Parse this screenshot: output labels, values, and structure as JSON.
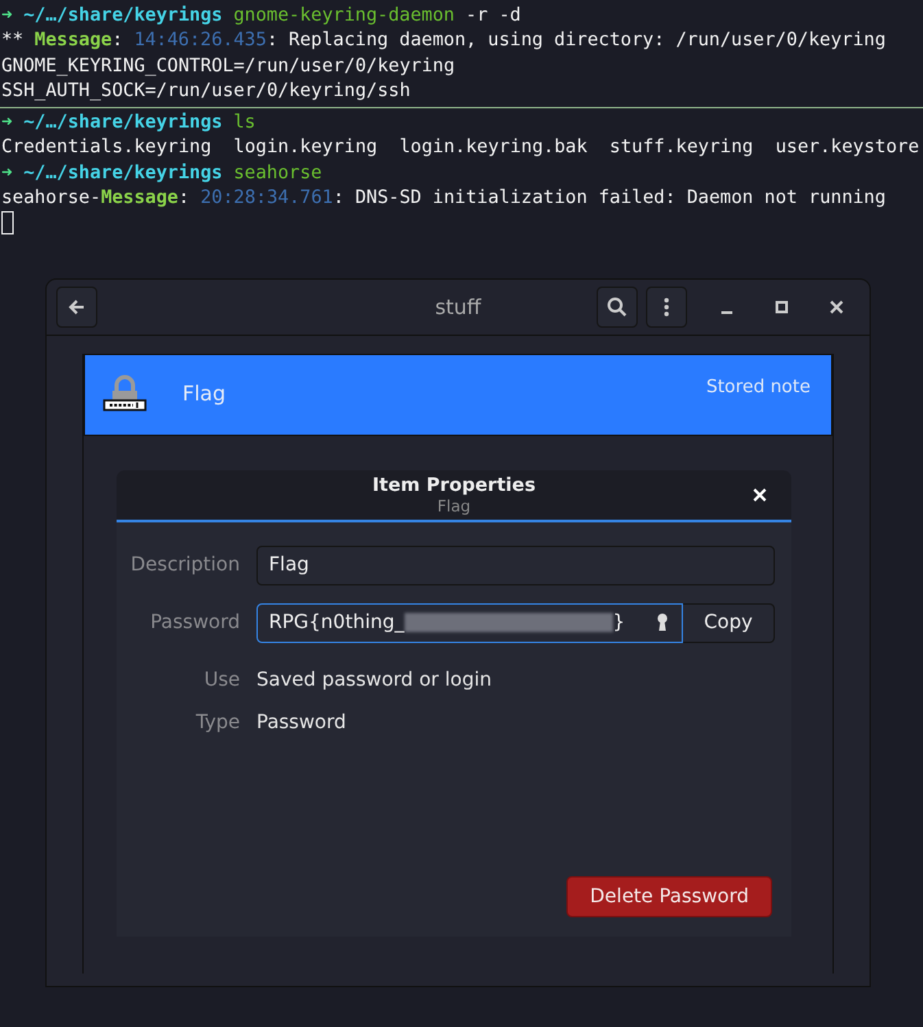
{
  "terminal": {
    "lines": [
      [
        {
          "kind": "arrow",
          "text": "➜"
        },
        {
          "kind": "path",
          "text": "~/…/share/keyrings"
        },
        {
          "kind": "command",
          "text": "gnome-keyring-daemon"
        },
        {
          "kind": "plain",
          "text": "-r -d"
        }
      ],
      [
        {
          "kind": "plain",
          "text": "**"
        },
        {
          "kind": "label",
          "text": "Message"
        },
        {
          "kind": "glue",
          "text": ":"
        },
        {
          "kind": "time",
          "text": "14:46:26.435"
        },
        {
          "kind": "glue",
          "text": ": Replacing daemon, using directory: /run/user/0/keyring"
        }
      ],
      [
        {
          "kind": "plain",
          "text": "GNOME_KEYRING_CONTROL=/run/user/0/keyring"
        }
      ],
      [
        {
          "kind": "plain",
          "text": "SSH_AUTH_SOCK=/run/user/0/keyring/ssh"
        }
      ],
      [
        {
          "kind": "rule"
        }
      ],
      [
        {
          "kind": "arrow",
          "text": "➜"
        },
        {
          "kind": "path",
          "text": "~/…/share/keyrings"
        },
        {
          "kind": "command",
          "text": "ls"
        }
      ],
      [
        {
          "kind": "plain",
          "text": "Credentials.keyring  login.keyring  login.keyring.bak  stuff.keyring  user.keystore"
        }
      ],
      [
        {
          "kind": "arrow",
          "text": "➜"
        },
        {
          "kind": "path",
          "text": "~/…/share/keyrings"
        },
        {
          "kind": "command",
          "text": "seahorse"
        }
      ],
      [
        {
          "kind": "glue",
          "text": "seahorse-"
        },
        {
          "kind": "label",
          "text": "Message"
        },
        {
          "kind": "glue",
          "text": ":"
        },
        {
          "kind": "time",
          "text": "20:28:34.761"
        },
        {
          "kind": "glue",
          "text": ": DNS-SD initialization failed: Daemon not running"
        }
      ],
      [
        {
          "kind": "cursor"
        }
      ]
    ]
  },
  "window": {
    "title": "stuff",
    "item": {
      "name": "Flag",
      "type": "Stored note",
      "selected": true
    },
    "dialog": {
      "title": "Item Properties",
      "subtitle": "Flag",
      "fields": [
        {
          "kind": "entry",
          "label": "Description",
          "value": "Flag",
          "focused": false
        },
        {
          "kind": "password",
          "label": "Password",
          "value": "RPG{n0thing_",
          "suffix": "}",
          "focused": true,
          "button": "Copy"
        },
        {
          "kind": "info",
          "label": "Use",
          "value": "Saved password or login"
        },
        {
          "kind": "info",
          "label": "Type",
          "value": "Password"
        }
      ],
      "delete_button": "Delete Password"
    }
  }
}
